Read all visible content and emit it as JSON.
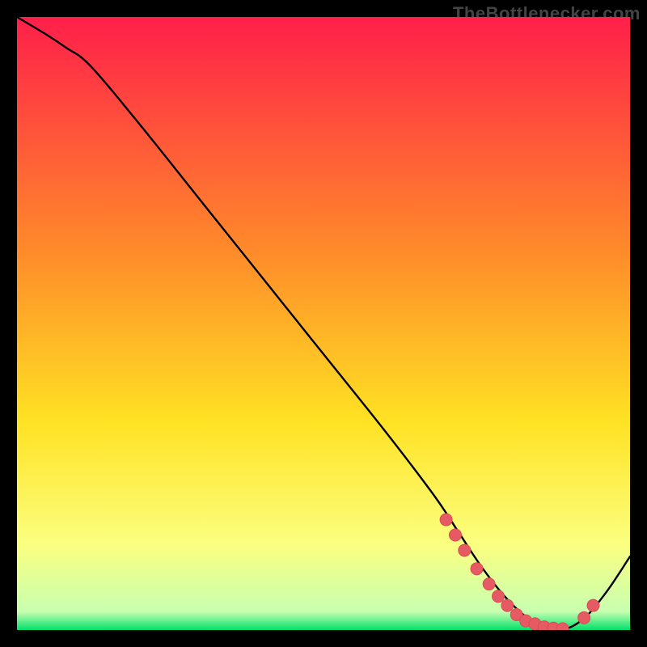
{
  "attribution": "TheBottlenecker.com",
  "colors": {
    "gradient_top": "#ff1f4a",
    "gradient_mid1": "#ff8a2a",
    "gradient_mid2": "#ffe223",
    "gradient_mid3": "#fbff80",
    "gradient_bottom": "#00e06a",
    "curve": "#000000",
    "marker_fill": "#e65a63",
    "marker_stroke": "#d94c55",
    "frame": "#000000"
  },
  "chart_data": {
    "type": "line",
    "title": "",
    "xlabel": "",
    "ylabel": "",
    "xlim": [
      0,
      100
    ],
    "ylim": [
      0,
      100
    ],
    "series": [
      {
        "name": "bottleneck-curve",
        "x": [
          0,
          5,
          8,
          12,
          20,
          30,
          40,
          50,
          60,
          68,
          72,
          76,
          80,
          84,
          88,
          92,
          96,
          100
        ],
        "y": [
          100,
          97,
          95,
          92,
          82.5,
          70,
          57.5,
          45,
          32.5,
          22,
          16,
          10,
          5,
          1.5,
          0,
          1.5,
          6,
          12
        ]
      }
    ],
    "markers": {
      "name": "highlight-points",
      "x": [
        70,
        71.5,
        73,
        75,
        77,
        78.5,
        80,
        81.5,
        83,
        84.5,
        86,
        87.5,
        89,
        92.5,
        94
      ],
      "y": [
        18,
        15.5,
        13,
        10,
        7.5,
        5.5,
        4,
        2.5,
        1.5,
        1,
        0.5,
        0.3,
        0.2,
        2,
        4
      ]
    }
  }
}
